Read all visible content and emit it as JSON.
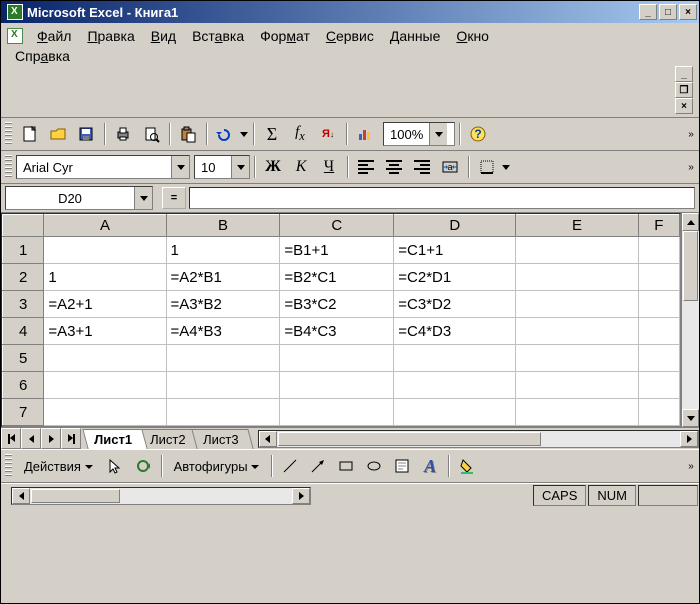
{
  "window": {
    "title": "Microsoft Excel - Книга1",
    "minimize": "_",
    "maximize": "□",
    "close": "×"
  },
  "menu": {
    "file": "Файл",
    "edit": "Правка",
    "view": "Вид",
    "insert": "Вставка",
    "format": "Формат",
    "tools": "Сервис",
    "data": "Данные",
    "window": "Окно",
    "help": "Справка"
  },
  "toolbar1": {
    "sum": "Σ",
    "fx": "fₓ",
    "sort": "Я↓A",
    "zoom": "100%"
  },
  "toolbar2": {
    "font": "Arial Cyr",
    "size": "10",
    "bold": "Ж",
    "italic": "К",
    "underline": "Ч"
  },
  "formula": {
    "cellref": "D20",
    "eq": "=",
    "value": ""
  },
  "columns": [
    "A",
    "B",
    "C",
    "D",
    "E",
    "F"
  ],
  "rows": [
    "1",
    "2",
    "3",
    "4",
    "5",
    "6",
    "7"
  ],
  "cells": {
    "r1": {
      "A": "",
      "B": "1",
      "C": "=B1+1",
      "D": "=C1+1",
      "E": "",
      "F": ""
    },
    "r2": {
      "A": "1",
      "B": "=A2*B1",
      "C": "=B2*C1",
      "D": "=C2*D1",
      "E": "",
      "F": ""
    },
    "r3": {
      "A": "=A2+1",
      "B": "=A3*B2",
      "C": "=B3*C2",
      "D": "=C3*D2",
      "E": "",
      "F": ""
    },
    "r4": {
      "A": "=A3+1",
      "B": "=A4*B3",
      "C": "=B4*C3",
      "D": "=C4*D3",
      "E": "",
      "F": ""
    },
    "r5": {
      "A": "",
      "B": "",
      "C": "",
      "D": "",
      "E": "",
      "F": ""
    },
    "r6": {
      "A": "",
      "B": "",
      "C": "",
      "D": "",
      "E": "",
      "F": ""
    },
    "r7": {
      "A": "",
      "B": "",
      "C": "",
      "D": "",
      "E": "",
      "F": ""
    }
  },
  "sheets": {
    "s1": "Лист1",
    "s2": "Лист2",
    "s3": "Лист3"
  },
  "drawbar": {
    "actions": "Действия",
    "autoshapes": "Автофигуры"
  },
  "status": {
    "caps": "CAPS",
    "num": "NUM"
  }
}
